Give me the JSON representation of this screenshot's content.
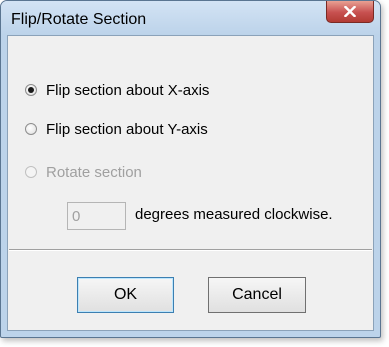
{
  "dialog": {
    "title": "Flip/Rotate Section",
    "close_icon": "close-icon"
  },
  "options": [
    {
      "label": "Flip section about X-axis",
      "selected": true,
      "enabled": true
    },
    {
      "label": "Flip section about Y-axis",
      "selected": false,
      "enabled": true
    },
    {
      "label": "Rotate section",
      "selected": false,
      "enabled": false
    }
  ],
  "rotation": {
    "value": "0",
    "unit_label": "degrees measured clockwise.",
    "enabled": false
  },
  "buttons": {
    "ok_label": "OK",
    "cancel_label": "Cancel"
  },
  "colors": {
    "title_bar": "#bcd3ea",
    "close_button": "#c75050",
    "client_bg": "#f0f0f0",
    "disabled_text": "#a0a0a0"
  }
}
